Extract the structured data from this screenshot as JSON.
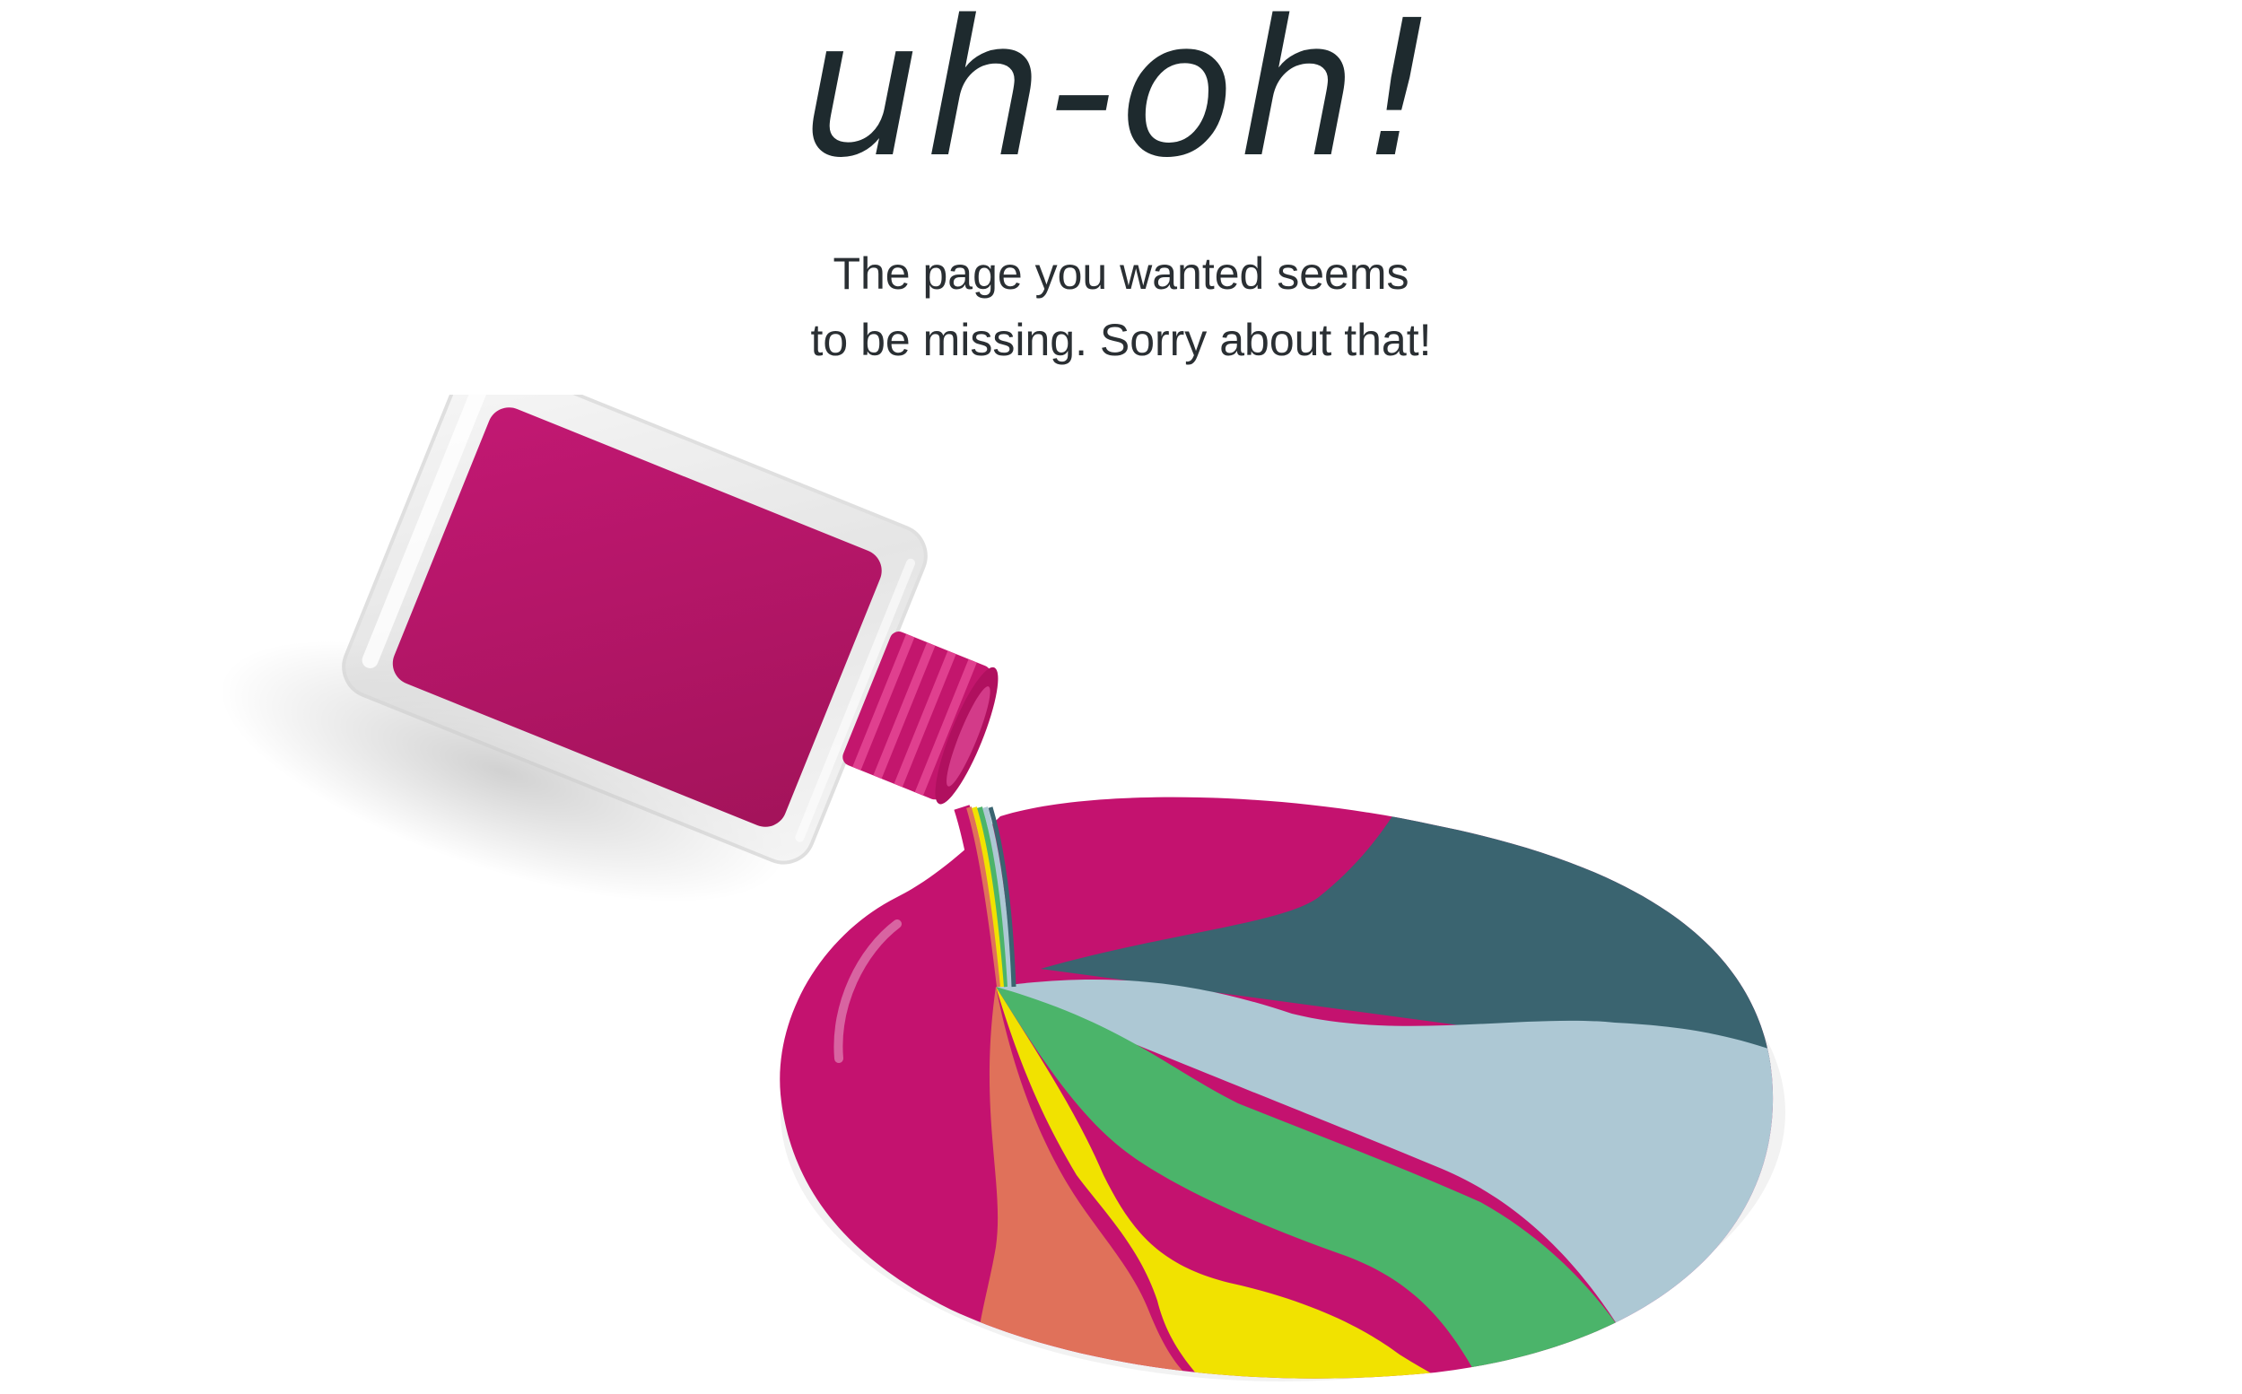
{
  "error_page": {
    "headline": "uh-oh!",
    "message_line_1": "The page you wanted seems",
    "message_line_2": "to be missing. Sorry about that!"
  },
  "illustration": {
    "icon": "spilled-nail-polish-illustration",
    "colors": {
      "bottle_polish": "#b0105f",
      "magenta": "#c4126f",
      "dark_teal": "#3a6470",
      "light_blue": "#adc8d4",
      "green": "#4bb46a",
      "yellow": "#f1e200",
      "orange": "#e0715a"
    }
  },
  "text_color": "#1e2a2e"
}
